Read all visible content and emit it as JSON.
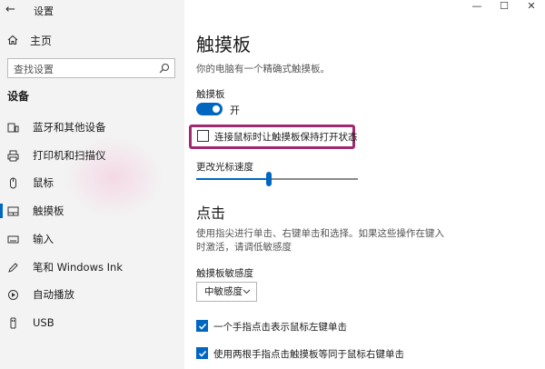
{
  "window": {
    "title": "设置",
    "minimize": "—",
    "maximize": "☐",
    "close": "✕"
  },
  "sidebar": {
    "home": "主页",
    "search_placeholder": "查找设置",
    "section": "设备",
    "items": [
      {
        "label": "蓝牙和其他设备",
        "icon": "bluetooth-devices-icon"
      },
      {
        "label": "打印机和扫描仪",
        "icon": "printer-icon"
      },
      {
        "label": "鼠标",
        "icon": "mouse-icon"
      },
      {
        "label": "触摸板",
        "icon": "touchpad-icon",
        "active": true
      },
      {
        "label": "输入",
        "icon": "keyboard-icon"
      },
      {
        "label": "笔和 Windows Ink",
        "icon": "pen-icon"
      },
      {
        "label": "自动播放",
        "icon": "autoplay-icon"
      },
      {
        "label": "USB",
        "icon": "usb-icon"
      }
    ]
  },
  "main": {
    "title": "触摸板",
    "description": "你的电脑有一个精确式触摸板。",
    "toggle_label": "触摸板",
    "toggle_state": "开",
    "toggle_on": true,
    "mouse_checkbox": {
      "label": "连接鼠标时让触摸板保持打开状态",
      "checked": false
    },
    "cursor_speed_label": "更改光标速度",
    "cursor_speed_fraction": 0.45,
    "taps_heading": "点击",
    "taps_description": "使用指尖进行单击、右键单击和选择。如果这些操作在键入时激活，请调低敏感度",
    "sensitivity_label": "触摸板敏感度",
    "sensitivity_value": "中敏感度",
    "tap_checkboxes": [
      {
        "label": "一个手指点击表示鼠标左键单击",
        "checked": true
      },
      {
        "label": "使用两根手指点击触摸板等同于鼠标右键单击",
        "checked": true
      }
    ]
  },
  "colors": {
    "accent": "#0067c0",
    "highlight_box": "#a02a6f",
    "sidebar_bg": "#f3f3f3"
  }
}
